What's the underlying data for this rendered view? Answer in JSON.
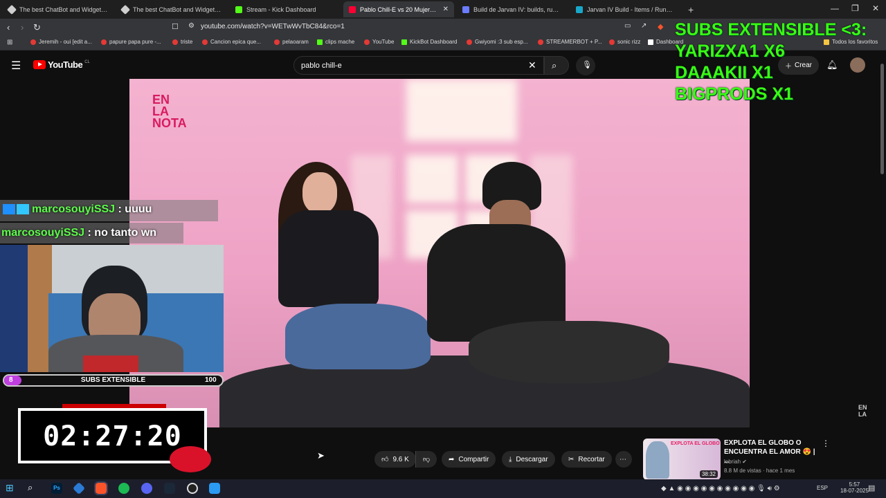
{
  "browser": {
    "tabs": [
      {
        "title": "The best ChatBot and Widgets for Kick",
        "color": "#cfcfcf",
        "active": false
      },
      {
        "title": "The best ChatBot and Widgets for Kick",
        "color": "#cfcfcf",
        "active": false
      },
      {
        "title": "Stream - Kick Dashboard",
        "color": "#53fc18",
        "active": false
      },
      {
        "title": "Pablo Chill-E vs 20 Mujeres -",
        "color": "#ff0033",
        "active": true
      },
      {
        "title": "Build de Jarvan IV: builds, runas e obj",
        "color": "#6b7cff",
        "active": false
      },
      {
        "title": "Jarvan IV Build - Items / Runes / Mat",
        "color": "#19a7c9",
        "active": false
      }
    ],
    "url": "youtube.com/watch?v=WETwWvTbC84&rco=1",
    "bookmarks": [
      "Jeremih - oui [edit a...",
      "papure papa pure -...",
      "triste",
      "Cancion epica que...",
      "pelaoaram",
      "clips mache",
      "YouTube",
      "KickBot Dashboard",
      "Gwiyomi :3 sub esp...",
      "STREAMERBOT + P...",
      "sonic rizz",
      "Dashboard",
      "Todos los favoritos"
    ]
  },
  "youtube": {
    "logo": "YouTube",
    "country": "CL",
    "search_value": "pablo chill-e",
    "create_label": "Crear",
    "like_count": "9.6 K",
    "share_label": "Compartir",
    "download_label": "Descargar",
    "clip_label": "Recortar",
    "recommendation": {
      "title": "EXPLOTA EL GLOBO O ENCUENTRA EL AMOR 😍 | ...",
      "channel": "lebriah",
      "meta": "8.8 M de vistas · hace 1 mes",
      "duration": "38:32",
      "thumb_text": "EXPLOTA EL GLOBO"
    },
    "video_watermark": [
      "EN",
      "LA",
      "NOTA"
    ]
  },
  "stream_overlay": {
    "subs_title": "SUBS EXTENSIBLE <3:",
    "subs_lines": [
      "YARIZXA1 X6",
      "DAAAKII X1",
      "BIGPRODS X1"
    ],
    "chat": [
      {
        "user": "marcosouyiSSJ",
        "msg": ": uuuu"
      },
      {
        "user": "marcosouyiSSJ",
        "msg": ": no tanto wn"
      }
    ],
    "subs_bar": {
      "current": "8",
      "label": "SUBS EXTENSIBLE",
      "goal": "100",
      "progress": 0.08
    },
    "timer": "02:27:20"
  },
  "taskbar": {
    "lang": "ESP",
    "time": "5:57",
    "date": "18-07-2025"
  }
}
